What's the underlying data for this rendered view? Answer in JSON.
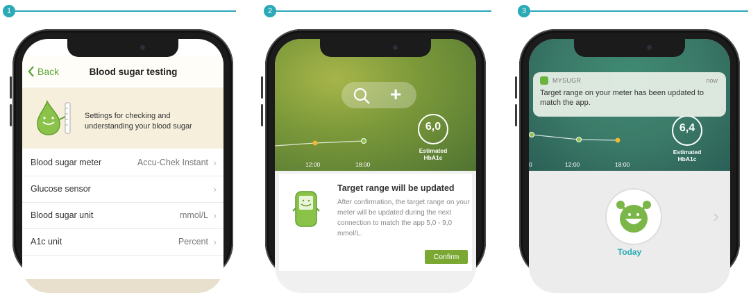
{
  "steps": [
    {
      "number": "1"
    },
    {
      "number": "2"
    },
    {
      "number": "3"
    }
  ],
  "colors": {
    "accent": "#2aa9b6",
    "green": "#5aa838",
    "confirm": "#7aa832"
  },
  "phone1": {
    "back_label": "Back",
    "title": "Blood sugar testing",
    "banner_text": "Settings for checking and understanding your blood sugar",
    "rows": [
      {
        "label": "Blood sugar meter",
        "value": "Accu-Chek Instant"
      },
      {
        "label": "Glucose sensor",
        "value": ""
      },
      {
        "label": "Blood sugar unit",
        "value": "mmol/L"
      },
      {
        "label": "A1c unit",
        "value": "Percent"
      }
    ]
  },
  "phone2": {
    "search_icon": "search-icon",
    "add_icon": "plus-icon",
    "hba1c_value": "6,0",
    "hba1c_label_1": "Estimated",
    "hba1c_label_2": "HbA1c",
    "time_1": "12:00",
    "time_2": "18:00",
    "card_title": "Target range will be updated",
    "card_body": "After confirmation, the target range on your meter will be updated during the next connection to match the app 5,0 - 9,0 mmol/L.",
    "confirm_label": "Confirm"
  },
  "phone3": {
    "app_name": "MYSUGR",
    "notif_time": "now",
    "notif_text": "Target range on your meter has been updated to match the app.",
    "hba1c_value": "6,4",
    "hba1c_label_1": "Estimated",
    "hba1c_label_2": "HbA1c",
    "time_0": "0",
    "time_1": "12:00",
    "time_2": "18:00",
    "today_label": "Today"
  }
}
